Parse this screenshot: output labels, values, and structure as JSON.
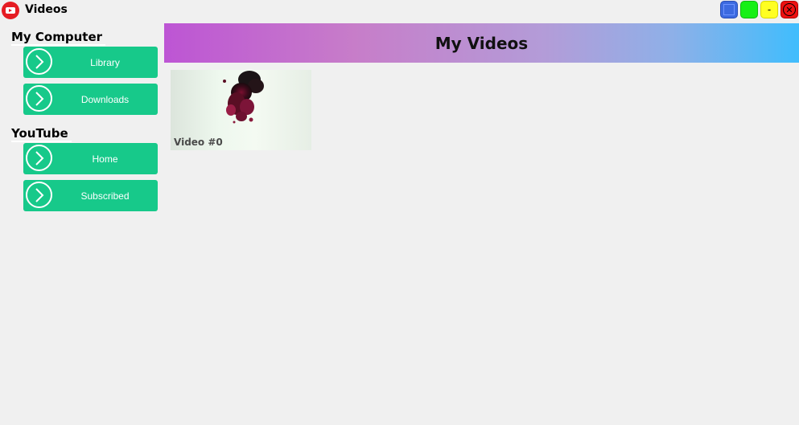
{
  "window": {
    "title": "Videos",
    "controls": [
      "",
      "",
      "-",
      "⊗"
    ]
  },
  "sidebar": {
    "sections": [
      {
        "title": "My Computer",
        "items": [
          {
            "label": "Library"
          },
          {
            "label": "Downloads"
          }
        ]
      },
      {
        "title": "YouTube",
        "items": [
          {
            "label": "Home"
          },
          {
            "label": "Subscribed"
          }
        ]
      }
    ]
  },
  "main": {
    "title": "My Videos",
    "videos": [
      {
        "label": "Video #0"
      }
    ]
  },
  "colors": {
    "nav_button": "#17c98a",
    "header_gradient_start": "#bd55d4",
    "header_gradient_end": "#40bdfd",
    "close_button": "#ee1111",
    "maximize_button": "#16f016",
    "minimize_button": "#ffff22",
    "restore_button": "#3c6ae0"
  }
}
